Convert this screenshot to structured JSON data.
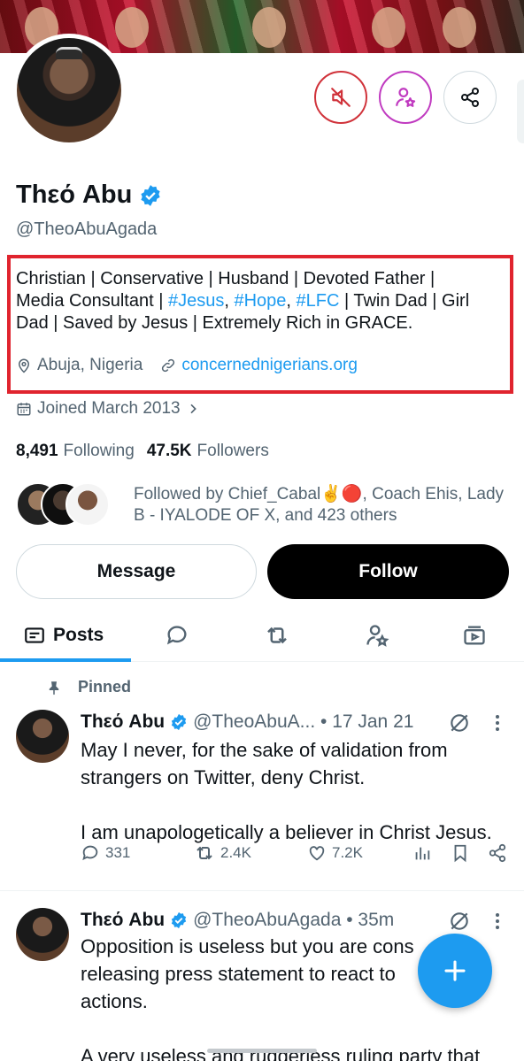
{
  "profile": {
    "name": "Thεό Abu",
    "handle": "@TheoAbuAgada",
    "bio_lines": [
      [
        {
          "t": "Christian | Conservative | Husband | Devoted Father |"
        }
      ],
      [
        {
          "t": "Media Consultant | "
        },
        {
          "t": "#Jesus",
          "tag": true
        },
        {
          "t": ", "
        },
        {
          "t": "#Hope",
          "tag": true
        },
        {
          "t": ", "
        },
        {
          "t": "#LFC",
          "tag": true
        },
        {
          "t": " | Twin Dad | Girl"
        }
      ],
      [
        {
          "t": "Dad | Saved by Jesus | Extremely Rich in GRACE."
        }
      ]
    ],
    "location": "Abuja, Nigeria",
    "website": "concernednigerians.org",
    "joined": "Joined March 2013",
    "following_count": "8,491",
    "following_label": "Following",
    "followers_count": "47.5K",
    "followers_label": "Followers",
    "followed_by_line1": "Followed by Chief_Cabal✌️🔴, Coach Ehis, Lady",
    "followed_by_line2": "B - IYALODE OF X, and 423 others"
  },
  "buttons": {
    "message": "Message",
    "follow": "Follow"
  },
  "tabs": {
    "posts": "Posts"
  },
  "posts": [
    {
      "pinned_label": "Pinned",
      "name": "Thεό Abu",
      "handle_time": "@TheoAbuA... • 17 Jan 21",
      "text_lines": [
        "May I never, for the sake of validation from",
        "strangers on Twitter, deny Christ.",
        "",
        "I am unapologetically a believer in Christ Jesus."
      ],
      "replies": "331",
      "reposts": "2.4K",
      "likes": "7.2K"
    },
    {
      "name": "Thεό Abu",
      "handle_time": "@TheoAbuAgada • 35m",
      "text_lines": [
        "Opposition is useless but you are cons",
        "releasing press statement to react to",
        "actions.",
        "",
        "A very useless and rudderless ruling party that"
      ]
    }
  ],
  "colors": {
    "accent": "#1d9bf0",
    "highlight_box": "#e0242e",
    "mute_ring": "#d0323a",
    "subscribe_ring": "#c03ac0"
  },
  "icons": [
    "mute-icon",
    "subscribe-icon",
    "share-icon",
    "verified-icon",
    "location-icon",
    "link-icon",
    "calendar-icon",
    "chevron-right-icon",
    "posts-tab-icon",
    "replies-tab-icon",
    "reposts-tab-icon",
    "highlights-tab-icon",
    "media-tab-icon",
    "pin-icon",
    "grok-icon",
    "more-icon",
    "reply-icon",
    "repost-icon",
    "like-icon",
    "analytics-icon",
    "bookmark-icon",
    "plus-icon"
  ]
}
